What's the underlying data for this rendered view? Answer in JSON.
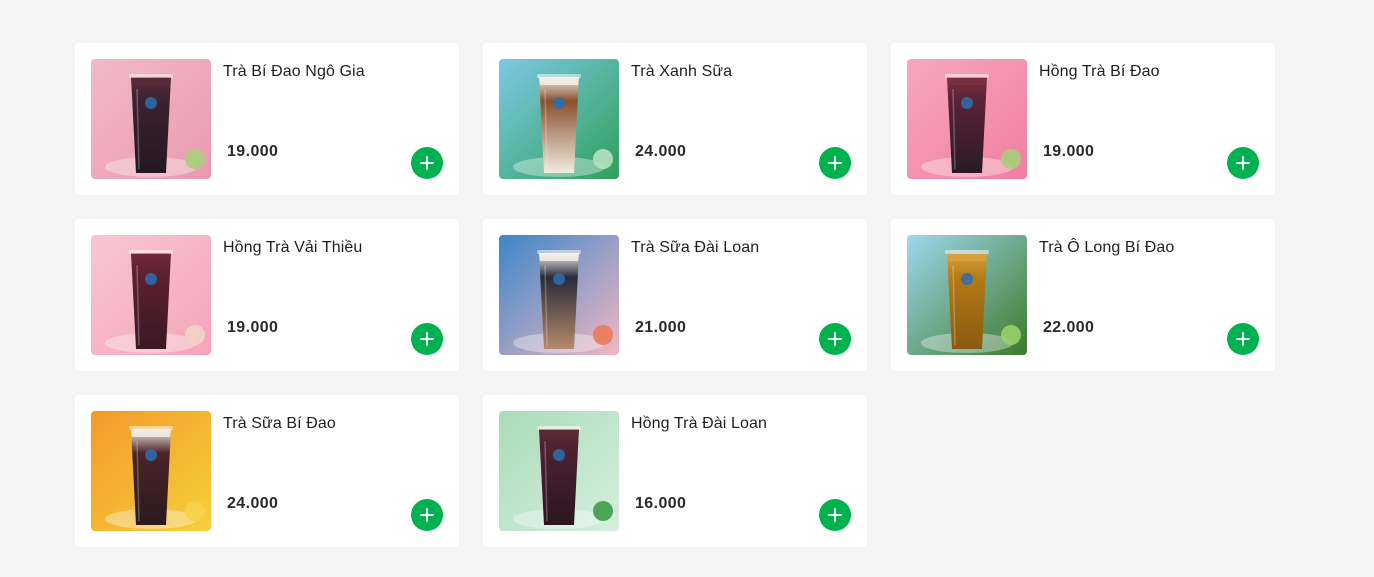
{
  "menu": {
    "items": [
      {
        "name": "Trà Bí Đao Ngô Gia",
        "price": "19.000",
        "image_icon": "drink-photo-icon",
        "colors": {
          "bg": "#f2b9c6",
          "bg2": "#e89aae",
          "drink": "#3a2230",
          "drink2": "#241722",
          "top": "#5b2a3a",
          "garnish": "#a9cf7a"
        }
      },
      {
        "name": "Trà Xanh Sữa",
        "price": "24.000",
        "image_icon": "drink-photo-icon",
        "colors": {
          "bg": "#7ec8e6",
          "bg2": "#2ea05a",
          "drink": "#8a4f2e",
          "drink2": "#f1ece0",
          "top": "#f3efe4",
          "garnish": "#b7e1c1"
        }
      },
      {
        "name": "Hồng Trà Bí Đao",
        "price": "19.000",
        "image_icon": "drink-photo-icon",
        "colors": {
          "bg": "#f6a8bd",
          "bg2": "#f17ea0",
          "drink": "#5a2236",
          "drink2": "#2b1a26",
          "top": "#7a3040",
          "garnish": "#a9cf7a"
        }
      },
      {
        "name": "Hồng Trà Vải Thiều",
        "price": "19.000",
        "image_icon": "drink-photo-icon",
        "colors": {
          "bg": "#f8c6d2",
          "bg2": "#f4a4b9",
          "drink": "#5c2030",
          "drink2": "#3a1824",
          "top": "#6e2838",
          "garnish": "#f2d3c4"
        }
      },
      {
        "name": "Trà Sữa Đài Loan",
        "price": "21.000",
        "image_icon": "drink-photo-icon",
        "colors": {
          "bg": "#3b86c8",
          "bg2": "#f1b7c3",
          "drink": "#2a2a3a",
          "drink2": "#b58a6a",
          "top": "#f4efe6",
          "garnish": "#e97a5b"
        }
      },
      {
        "name": "Trà Ô Long Bí Đao",
        "price": "22.000",
        "image_icon": "drink-photo-icon",
        "colors": {
          "bg": "#9fd7ee",
          "bg2": "#3d7a2a",
          "drink": "#b57a16",
          "drink2": "#8a5a10",
          "top": "#d9a13a",
          "garnish": "#98d26b"
        }
      },
      {
        "name": "Trà Sữa Bí Đao",
        "price": "24.000",
        "image_icon": "drink-photo-icon",
        "colors": {
          "bg": "#f39a2a",
          "bg2": "#f6cf3a",
          "drink": "#4a2428",
          "drink2": "#2c1a1e",
          "top": "#f3eee4",
          "garnish": "#f4d24a"
        }
      },
      {
        "name": "Hồng Trà Đài Loan",
        "price": "16.000",
        "image_icon": "drink-photo-icon",
        "colors": {
          "bg": "#a8dcb9",
          "bg2": "#d6eedd",
          "drink": "#4c2030",
          "drink2": "#2a1620",
          "top": "#5a2a34",
          "garnish": "#3e9c4a"
        }
      }
    ],
    "add_button_icon": "plus-icon",
    "accent": "#00b14f"
  }
}
